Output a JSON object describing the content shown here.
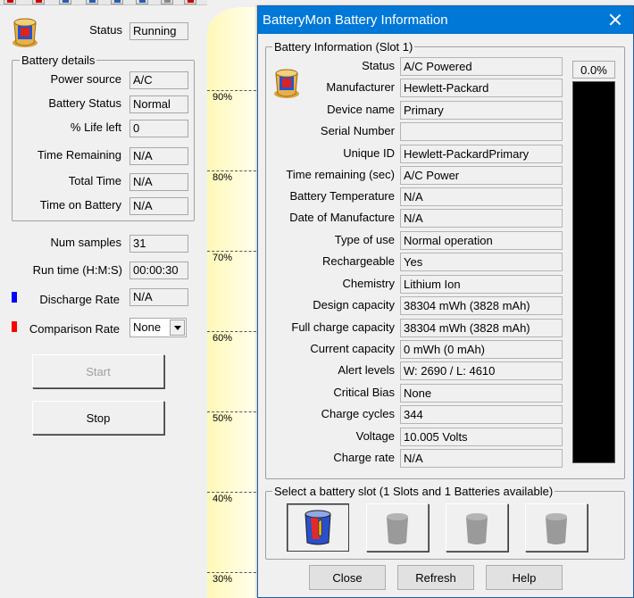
{
  "main": {
    "status": {
      "label": "Status",
      "value": "Running"
    },
    "battery_details": {
      "title": "Battery details",
      "rows": [
        {
          "label": "Power source",
          "value": "A/C"
        },
        {
          "label": "Battery Status",
          "value": "Normal"
        },
        {
          "label": "% Life left",
          "value": "0"
        },
        {
          "label": "Time Remaining",
          "value": "N/A"
        },
        {
          "label": "Total Time",
          "value": "N/A"
        },
        {
          "label": "Time on Battery",
          "value": "N/A"
        }
      ]
    },
    "num_samples": {
      "label": "Num samples",
      "value": "31"
    },
    "run_time": {
      "label": "Run time (H:M:S)",
      "value": "00:00:30"
    },
    "discharge_rate": {
      "label": "Discharge Rate",
      "value": "N/A",
      "color": "#0000ff"
    },
    "comparison_rate": {
      "label": "Comparison Rate",
      "value": "None",
      "color": "#ff0000"
    },
    "start_label": "Start",
    "stop_label": "Stop",
    "graph": {
      "background": "#fffff2",
      "percent_labels": [
        "90%",
        "80%",
        "70%",
        "60%",
        "50%",
        "40%",
        "30%"
      ]
    }
  },
  "dialog": {
    "title": "BatteryMon Battery Information",
    "group_title": "Battery Information (Slot 1)",
    "fields": [
      {
        "label": "Status",
        "value": "A/C Powered"
      },
      {
        "label": "Manufacturer",
        "value": "Hewlett-Packard"
      },
      {
        "label": "Device name",
        "value": "Primary"
      },
      {
        "label": "Serial Number",
        "value": ""
      },
      {
        "label": "Unique ID",
        "value": "Hewlett-PackardPrimary"
      },
      {
        "label": "Time remaining (sec)",
        "value": "A/C Power"
      },
      {
        "label": "Battery Temperature",
        "value": "N/A"
      },
      {
        "label": "Date of Manufacture",
        "value": "N/A"
      },
      {
        "label": "Type of use",
        "value": "Normal operation"
      },
      {
        "label": "Rechargeable",
        "value": "Yes"
      },
      {
        "label": "Chemistry",
        "value": "Lithium Ion"
      },
      {
        "label": "Design capacity",
        "value": "38304 mWh (3828 mAh)"
      },
      {
        "label": "Full charge capacity",
        "value": "38304 mWh (3828 mAh)"
      },
      {
        "label": "Current capacity",
        "value": "0 mWh (0 mAh)"
      },
      {
        "label": "Alert levels",
        "value": "W: 2690 / L: 4610"
      },
      {
        "label": "Critical Bias",
        "value": "None"
      },
      {
        "label": "Charge cycles",
        "value": "344"
      },
      {
        "label": "Voltage",
        "value": "10.005 Volts"
      },
      {
        "label": "Charge rate",
        "value": "N/A"
      }
    ],
    "charge_percent": "0.0%",
    "charge_fraction": 0.0,
    "slot_group_title": "Select a battery slot (1 Slots and 1 Batteries available)",
    "slots": [
      {
        "icon": "battery-slot-1-icon",
        "active": true
      },
      {
        "icon": "empty-slot-icon",
        "active": false
      },
      {
        "icon": "empty-slot-icon",
        "active": false
      },
      {
        "icon": "empty-slot-icon",
        "active": false
      }
    ],
    "buttons": {
      "close": "Close",
      "refresh": "Refresh",
      "help": "Help"
    }
  }
}
